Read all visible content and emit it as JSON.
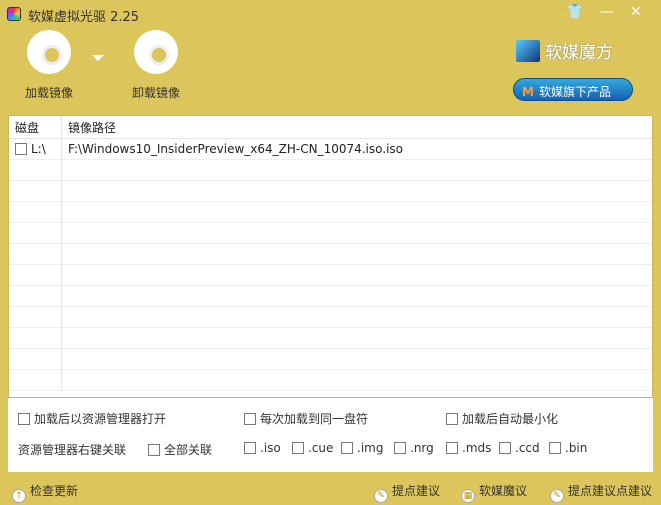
{
  "window": {
    "title": "软媒虚拟光驱 2.25"
  },
  "toolbar": {
    "mount": "加载镜像",
    "unmount": "卸载镜像"
  },
  "brand": {
    "name": "软媒魔方",
    "products": "软媒旗下产品",
    "products_logo": "M"
  },
  "table": {
    "headers": [
      "磁盘",
      "镜像路径"
    ],
    "rows": [
      {
        "drive": "L:\\",
        "path": "F:\\Windows10_InsiderPreview_x64_ZH-CN_10074.iso.iso"
      }
    ]
  },
  "options": {
    "open_explorer": "加载后以资源管理器打开",
    "same_drive": "每次加载到同一盘符",
    "minimize": "加载后自动最小化",
    "assoc_label": "资源管理器右键关联",
    "all": "全部关联",
    "exts": [
      ".iso",
      ".cue",
      ".img",
      ".nrg",
      ".mds",
      ".ccd",
      ".bin"
    ]
  },
  "footer": {
    "update": "检查更新",
    "suggest": "提点建议",
    "mofang": "软媒魔议",
    "suggest2": "提点建议点建议"
  }
}
